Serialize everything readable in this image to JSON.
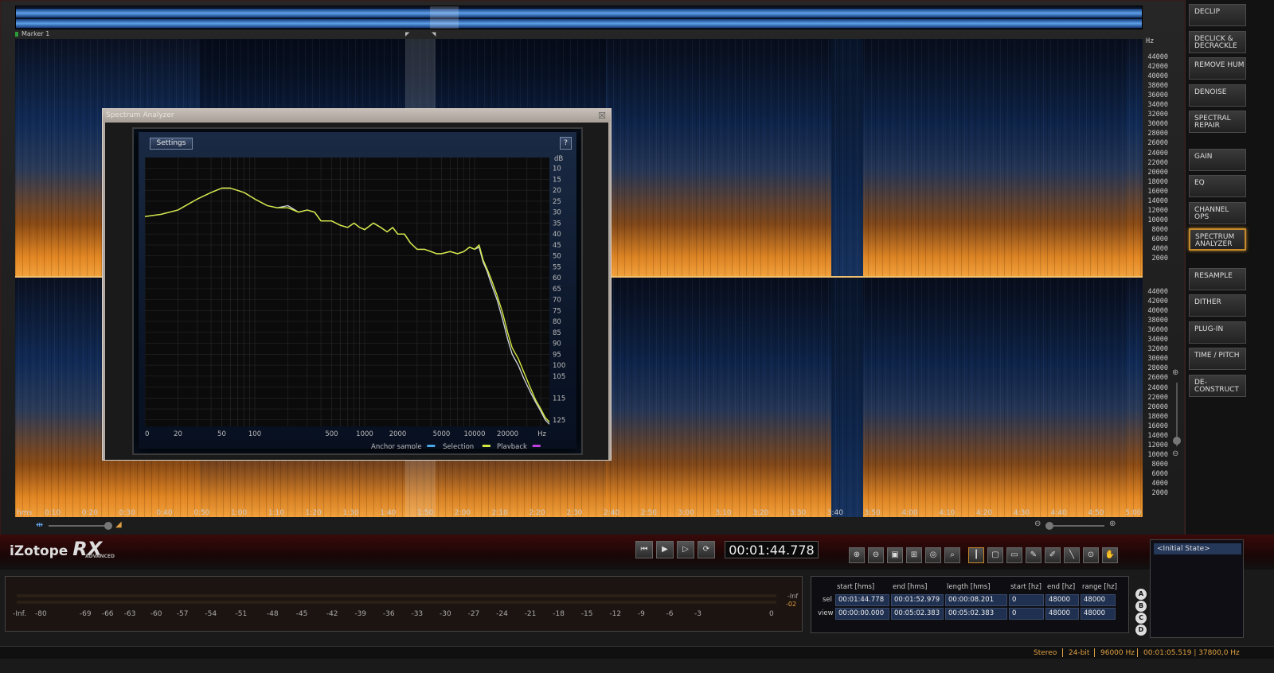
{
  "overview": {
    "marker_label": "Marker 1"
  },
  "freq_scale": {
    "unit": "Hz",
    "top_ticks": [
      "44000",
      "42000",
      "40000",
      "38000",
      "36000",
      "34000",
      "32000",
      "30000",
      "28000",
      "26000",
      "24000",
      "22000",
      "20000",
      "18000",
      "16000",
      "14000",
      "12000",
      "10000",
      "8000",
      "6000",
      "4000",
      "2000"
    ],
    "bottom_ticks": [
      "44000",
      "42000",
      "40000",
      "38000",
      "36000",
      "34000",
      "32000",
      "30000",
      "28000",
      "26000",
      "24000",
      "22000",
      "20000",
      "18000",
      "16000",
      "14000",
      "12000",
      "10000",
      "8000",
      "6000",
      "4000",
      "2000"
    ]
  },
  "time_axis": {
    "unit_label": "hms",
    "ticks": [
      "0:10",
      "0:20",
      "0:30",
      "0:40",
      "0:50",
      "1:00",
      "1:10",
      "1:20",
      "1:30",
      "1:40",
      "1:50",
      "2:00",
      "2:10",
      "2:20",
      "2:30",
      "2:40",
      "2:50",
      "3:00",
      "3:10",
      "3:20",
      "3:30",
      "3:40",
      "3:50",
      "4:00",
      "4:10",
      "4:20",
      "4:30",
      "4:40",
      "4:50",
      "5:00"
    ]
  },
  "modules": [
    "DECLIP",
    "DECLICK & DECRACKLE",
    "REMOVE HUM",
    "DENOISE",
    "SPECTRAL REPAIR",
    "GAIN",
    "EQ",
    "CHANNEL OPS",
    "SPECTRUM ANALYZER",
    "RESAMPLE",
    "DITHER",
    "PLUG-IN",
    "TIME / PITCH",
    "DE-CONSTRUCT"
  ],
  "active_module": "SPECTRUM ANALYZER",
  "logo": {
    "brand": "iZotope",
    "product": "RX",
    "edition": "ADVANCED"
  },
  "transport": {
    "timecode": "00:01:44.778",
    "buttons": [
      "skip-start-icon",
      "play-icon",
      "play-selection-icon",
      "loop-icon"
    ]
  },
  "tools": [
    "zoom-in-icon",
    "zoom-out-icon",
    "zoom-selection-icon",
    "zoom-fit-icon",
    "zoom-time-icon",
    "zoom-freq-icon",
    "time-select-icon",
    "rect-select-icon",
    "freq-select-icon",
    "lasso-icon",
    "brush-icon",
    "wand-icon",
    "find-similar-icon",
    "hand-icon"
  ],
  "history": {
    "items": [
      "<Initial State>"
    ]
  },
  "meter": {
    "scale": [
      "-Inf.",
      "-80",
      "-69",
      "-66",
      "-63",
      "-60",
      "-57",
      "-54",
      "-51",
      "-48",
      "-45",
      "-42",
      "-39",
      "-36",
      "-33",
      "-30",
      "-27",
      "-24",
      "-21",
      "-18",
      "-15",
      "-12",
      "-9",
      "-6",
      "-3",
      "0"
    ],
    "peak_top": "-Inf",
    "peak_bottom": "-02"
  },
  "selection_info": {
    "headers": [
      "start [hms]",
      "end [hms]",
      "length [hms]",
      "start [hz]",
      "end [hz]",
      "range [hz]"
    ],
    "rows": [
      {
        "label": "sel",
        "values": [
          "00:01:44.778",
          "00:01:52.979",
          "00:00:08.201",
          "0",
          "48000",
          "48000"
        ]
      },
      {
        "label": "view",
        "values": [
          "00:00:00.000",
          "00:05:02.383",
          "00:05:02.383",
          "0",
          "48000",
          "48000"
        ]
      }
    ]
  },
  "ab_buttons": [
    "A",
    "B",
    "C",
    "D"
  ],
  "status": {
    "channels": "Stereo",
    "bit_depth": "24-bit",
    "sample_rate": "96000 Hz",
    "cursor": "00:01:05.519 | 37800,0 Hz"
  },
  "analyzer": {
    "title": "Spectrum Analyzer",
    "settings_label": "Settings",
    "help_label": "?",
    "legend": [
      {
        "label": "Anchor sample",
        "color": "#4aa8e8"
      },
      {
        "label": "Selection",
        "color": "#d4e840"
      },
      {
        "label": "Playback",
        "color": "#c040e0"
      }
    ]
  },
  "chart_data": {
    "type": "line",
    "xlabel": "Hz",
    "ylabel": "dB",
    "x_scale": "log",
    "xlim": [
      10,
      48000
    ],
    "ylim": [
      5,
      128
    ],
    "y_inverted": true,
    "x_ticks": [
      "10",
      "20",
      "50",
      "100",
      "500",
      "1000",
      "2000",
      "5000",
      "10000",
      "20000"
    ],
    "y_ticks": [
      "10",
      "15",
      "20",
      "25",
      "30",
      "35",
      "40",
      "45",
      "50",
      "55",
      "60",
      "65",
      "70",
      "75",
      "80",
      "85",
      "90",
      "95",
      "100",
      "105",
      "115",
      "125"
    ],
    "grid": true,
    "series": [
      {
        "name": "Selection",
        "color": "#d4e840",
        "x": [
          10,
          14,
          20,
          30,
          40,
          50,
          60,
          80,
          100,
          130,
          160,
          200,
          250,
          300,
          350,
          400,
          500,
          600,
          700,
          800,
          900,
          1000,
          1200,
          1400,
          1600,
          1800,
          2000,
          2300,
          2600,
          3000,
          3500,
          4000,
          4500,
          5000,
          6000,
          7000,
          8000,
          9000,
          10000,
          11000,
          12000,
          13000,
          14000,
          16000,
          18000,
          20000,
          22000,
          25000,
          28000,
          32000,
          36000,
          40000,
          44000,
          48000
        ],
        "y": [
          32,
          31,
          29,
          24,
          21,
          19,
          19,
          21,
          24,
          27,
          28,
          28,
          30,
          29,
          30,
          34,
          34,
          36,
          37,
          35,
          37,
          38,
          35,
          37,
          39,
          37,
          40,
          40,
          44,
          47,
          47,
          48,
          49,
          49,
          48,
          49,
          48,
          46,
          47,
          45,
          52,
          56,
          60,
          68,
          76,
          85,
          92,
          97,
          103,
          110,
          116,
          120,
          124,
          126
        ]
      },
      {
        "name": "Anchor sample",
        "color": "#c8d0d8",
        "x": [
          10,
          14,
          20,
          30,
          40,
          50,
          60,
          80,
          100,
          130,
          160,
          200,
          250,
          300,
          350,
          400,
          500,
          600,
          700,
          800,
          900,
          1000,
          1200,
          1400,
          1600,
          1800,
          2000,
          2300,
          2600,
          3000,
          3500,
          4000,
          4500,
          5000,
          6000,
          7000,
          8000,
          9000,
          10000,
          11000,
          12000,
          13000,
          14000,
          16000,
          18000,
          20000,
          22000,
          25000,
          28000,
          32000,
          36000,
          40000,
          44000,
          48000
        ],
        "y": [
          32,
          31,
          29,
          24,
          21,
          19,
          19,
          21,
          24,
          27,
          28,
          27,
          30,
          29,
          30,
          34,
          34,
          36,
          37,
          35,
          37,
          38,
          35,
          37,
          39,
          37,
          40,
          40,
          44,
          47,
          47,
          48,
          49,
          49,
          48,
          49,
          48,
          46,
          47,
          46,
          53,
          57,
          62,
          70,
          79,
          88,
          95,
          100,
          106,
          112,
          117,
          121,
          125,
          127
        ]
      }
    ]
  }
}
